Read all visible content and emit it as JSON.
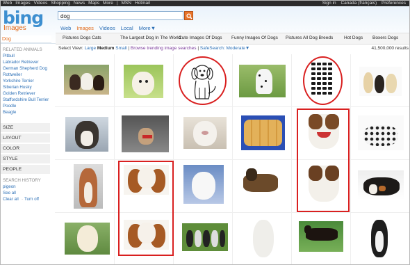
{
  "topbar": {
    "links": [
      "Web",
      "Images",
      "Videos",
      "Shopping",
      "News",
      "Maps",
      "More",
      "|",
      "MSN",
      "Hotmail"
    ],
    "sign_in": "Sign in",
    "region": "Canada (français)",
    "preferences": "Preferences"
  },
  "logo": {
    "text": "bing",
    "section": "Images"
  },
  "search": {
    "value": "dog"
  },
  "tabs": [
    {
      "label": "Web",
      "active": false
    },
    {
      "label": "Images",
      "active": true
    },
    {
      "label": "Videos",
      "active": false
    },
    {
      "label": "Local",
      "active": false
    },
    {
      "label": "More▼",
      "active": false
    }
  ],
  "current_query": "Dog",
  "related_searches": [
    "Pictures Dogs Cats",
    "The Largest Dog In The World",
    "Cute Images Of Dogs",
    "Funny Images Of Dogs",
    "Pictures All Dog Breeds",
    "Hot Dogs",
    "Boxers Dogs"
  ],
  "options": {
    "select_view": "Select View:",
    "large": "Large",
    "medium": "Medium",
    "small": "Small",
    "separator": "|",
    "browse": "Browse trending image searches",
    "safesearch": "SafeSearch: Moderate▼",
    "results": "41,500,000 results"
  },
  "sidebar": {
    "related_title": "RELATED ANIMALS",
    "related": [
      "Pitbull",
      "Labrador Retriever",
      "German Shepherd Dog",
      "Rottweiler",
      "Yorkshire Terrier",
      "Siberian Husky",
      "Golden Retriever",
      "Staffordshire Bull Terrier",
      "Poodle",
      "Beagle"
    ],
    "facets": [
      "SIZE",
      "LAYOUT",
      "COLOR",
      "STYLE",
      "PEOPLE"
    ],
    "history_title": "SEARCH HISTORY",
    "history": [
      "pigeon"
    ],
    "see_all": "See all",
    "clear_all": "Clear all",
    "dot": "·",
    "turn_off": "Turn off"
  },
  "colors": {
    "highlight": "#d92020",
    "link": "#2b6fb6",
    "accent": "#e26a1a"
  }
}
